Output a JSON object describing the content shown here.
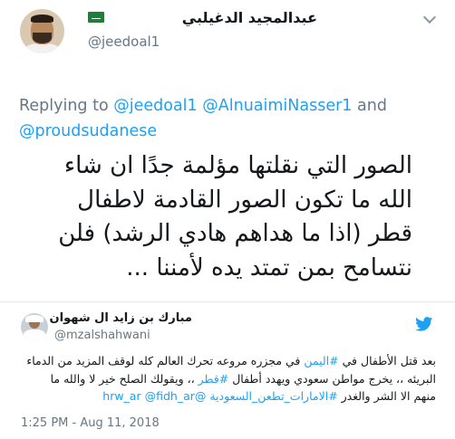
{
  "main_tweet": {
    "display_name": "عبدالمجيد الدغيلبي",
    "handle": "@jeedoal1",
    "flag_icon": "saudi-flag-icon",
    "replying_prefix": "Replying to",
    "reply_mentions": [
      "@jeedoal1",
      "@AlnuaimiNasser1",
      "@proudsudanese"
    ],
    "reply_and": "and",
    "text": "الصور التي نقلتها مؤلمة جدًا ان شاء الله ما تكون الصور القادمة لاطفال قطر (اذا ما هداهم هادي الرشد) فلن نتسامح بمن تمتد يده لأمننا ..."
  },
  "quoted_tweet": {
    "display_name": "مبارك بن زايد ال شهوان",
    "handle": "@mzalshahwani",
    "icon": "twitter-bird-icon",
    "text_line1_a": "بعد قتل الأطفال في ",
    "text_line1_link": "#اليمن",
    "text_line1_b": " في مجزره مروعه تحرك العالم كله لوقف المزيد من الدماء",
    "text_line2_a": "البريئه ،، يخرج مواطن سعودي ويهدد أطفال ",
    "text_line2_link": "#قطر",
    "text_line2_b": " ،، ويقولك الصلح خير لا والله ما",
    "text_line3_a": "منهم الا الشر والغدر ",
    "text_line3_link1": "#الامارات_تطعن_السعودية",
    "text_line3_link2": "@hrw_ar",
    "text_line3_link3": "@fidh_ar",
    "timestamp": "1:25 PM - Aug 11, 2018"
  },
  "colors": {
    "link": "#1da1f2",
    "secondary_text": "#657786",
    "divider": "#e1e8ed"
  }
}
